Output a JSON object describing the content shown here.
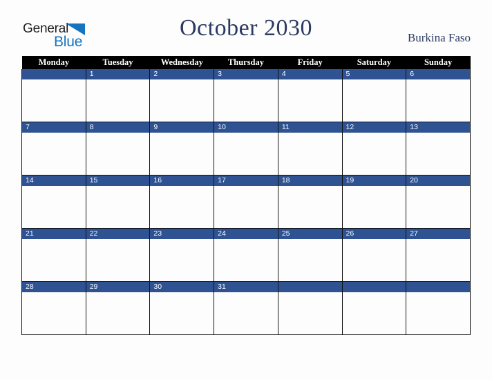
{
  "branding": {
    "logo_word_1": "General",
    "logo_word_2": "Blue",
    "triangle_color": "#1574bf"
  },
  "header": {
    "title": "October 2030",
    "country": "Burkina Faso",
    "title_color": "#2b3a62"
  },
  "calendar": {
    "weekday_headers": [
      "Monday",
      "Tuesday",
      "Wednesday",
      "Thursday",
      "Friday",
      "Saturday",
      "Sunday"
    ],
    "header_background": "#000000",
    "day_band_color": "#2e5292",
    "weeks": [
      {
        "days": [
          "",
          "1",
          "2",
          "3",
          "4",
          "5",
          "6"
        ]
      },
      {
        "days": [
          "7",
          "8",
          "9",
          "10",
          "11",
          "12",
          "13"
        ]
      },
      {
        "days": [
          "14",
          "15",
          "16",
          "17",
          "18",
          "19",
          "20"
        ]
      },
      {
        "days": [
          "21",
          "22",
          "23",
          "24",
          "25",
          "26",
          "27"
        ]
      },
      {
        "days": [
          "28",
          "29",
          "30",
          "31",
          "",
          "",
          ""
        ]
      }
    ]
  }
}
